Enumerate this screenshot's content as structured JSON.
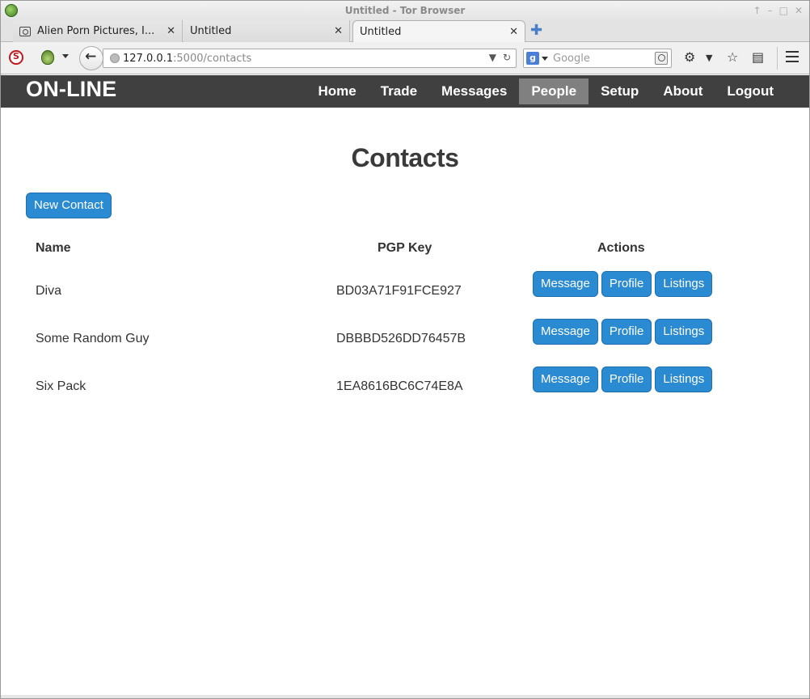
{
  "window": {
    "title": "Untitled - Tor Browser"
  },
  "tabs": [
    {
      "label": "Alien Porn Pictures, I...",
      "active": false
    },
    {
      "label": "Untitled",
      "active": false
    },
    {
      "label": "Untitled",
      "active": true
    }
  ],
  "urlbar": {
    "host": "127.0.0.1",
    "path": ":5000/contacts"
  },
  "search": {
    "placeholder": "Google",
    "engine_badge": "g"
  },
  "site": {
    "brand": "ON-LINE",
    "menu": [
      "Home",
      "Trade",
      "Messages",
      "People",
      "Setup",
      "About",
      "Logout"
    ],
    "active_menu": "People"
  },
  "page": {
    "heading": "Contacts",
    "new_contact_label": "New Contact",
    "columns": {
      "name": "Name",
      "pgp": "PGP Key",
      "actions": "Actions"
    },
    "contacts": [
      {
        "name": "Diva",
        "pgp": "BD03A71F91FCE927"
      },
      {
        "name": "Some Random Guy",
        "pgp": "DBBBD526DD76457B"
      },
      {
        "name": "Six Pack",
        "pgp": "1EA8616BC6C74E8A"
      }
    ],
    "actions": {
      "message": "Message",
      "profile": "Profile",
      "listings": "Listings"
    }
  },
  "colors": {
    "nav_bg": "#404040",
    "active_menu_bg": "#808080",
    "button_blue": "#2a8bd3"
  }
}
